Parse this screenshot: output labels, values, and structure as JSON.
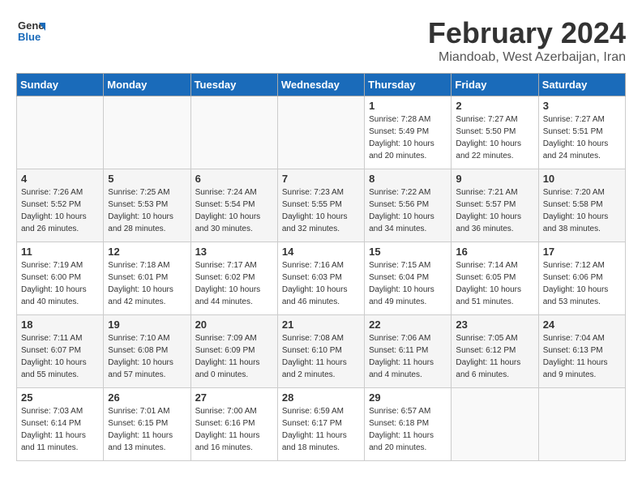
{
  "header": {
    "logo_general": "General",
    "logo_blue": "Blue",
    "month_year": "February 2024",
    "location": "Miandoab, West Azerbaijan, Iran"
  },
  "days_of_week": [
    "Sunday",
    "Monday",
    "Tuesday",
    "Wednesday",
    "Thursday",
    "Friday",
    "Saturday"
  ],
  "weeks": [
    [
      {
        "day": "",
        "sunrise": "",
        "sunset": "",
        "daylight": ""
      },
      {
        "day": "",
        "sunrise": "",
        "sunset": "",
        "daylight": ""
      },
      {
        "day": "",
        "sunrise": "",
        "sunset": "",
        "daylight": ""
      },
      {
        "day": "",
        "sunrise": "",
        "sunset": "",
        "daylight": ""
      },
      {
        "day": "1",
        "sunrise": "Sunrise: 7:28 AM",
        "sunset": "Sunset: 5:49 PM",
        "daylight": "Daylight: 10 hours and 20 minutes."
      },
      {
        "day": "2",
        "sunrise": "Sunrise: 7:27 AM",
        "sunset": "Sunset: 5:50 PM",
        "daylight": "Daylight: 10 hours and 22 minutes."
      },
      {
        "day": "3",
        "sunrise": "Sunrise: 7:27 AM",
        "sunset": "Sunset: 5:51 PM",
        "daylight": "Daylight: 10 hours and 24 minutes."
      }
    ],
    [
      {
        "day": "4",
        "sunrise": "Sunrise: 7:26 AM",
        "sunset": "Sunset: 5:52 PM",
        "daylight": "Daylight: 10 hours and 26 minutes."
      },
      {
        "day": "5",
        "sunrise": "Sunrise: 7:25 AM",
        "sunset": "Sunset: 5:53 PM",
        "daylight": "Daylight: 10 hours and 28 minutes."
      },
      {
        "day": "6",
        "sunrise": "Sunrise: 7:24 AM",
        "sunset": "Sunset: 5:54 PM",
        "daylight": "Daylight: 10 hours and 30 minutes."
      },
      {
        "day": "7",
        "sunrise": "Sunrise: 7:23 AM",
        "sunset": "Sunset: 5:55 PM",
        "daylight": "Daylight: 10 hours and 32 minutes."
      },
      {
        "day": "8",
        "sunrise": "Sunrise: 7:22 AM",
        "sunset": "Sunset: 5:56 PM",
        "daylight": "Daylight: 10 hours and 34 minutes."
      },
      {
        "day": "9",
        "sunrise": "Sunrise: 7:21 AM",
        "sunset": "Sunset: 5:57 PM",
        "daylight": "Daylight: 10 hours and 36 minutes."
      },
      {
        "day": "10",
        "sunrise": "Sunrise: 7:20 AM",
        "sunset": "Sunset: 5:58 PM",
        "daylight": "Daylight: 10 hours and 38 minutes."
      }
    ],
    [
      {
        "day": "11",
        "sunrise": "Sunrise: 7:19 AM",
        "sunset": "Sunset: 6:00 PM",
        "daylight": "Daylight: 10 hours and 40 minutes."
      },
      {
        "day": "12",
        "sunrise": "Sunrise: 7:18 AM",
        "sunset": "Sunset: 6:01 PM",
        "daylight": "Daylight: 10 hours and 42 minutes."
      },
      {
        "day": "13",
        "sunrise": "Sunrise: 7:17 AM",
        "sunset": "Sunset: 6:02 PM",
        "daylight": "Daylight: 10 hours and 44 minutes."
      },
      {
        "day": "14",
        "sunrise": "Sunrise: 7:16 AM",
        "sunset": "Sunset: 6:03 PM",
        "daylight": "Daylight: 10 hours and 46 minutes."
      },
      {
        "day": "15",
        "sunrise": "Sunrise: 7:15 AM",
        "sunset": "Sunset: 6:04 PM",
        "daylight": "Daylight: 10 hours and 49 minutes."
      },
      {
        "day": "16",
        "sunrise": "Sunrise: 7:14 AM",
        "sunset": "Sunset: 6:05 PM",
        "daylight": "Daylight: 10 hours and 51 minutes."
      },
      {
        "day": "17",
        "sunrise": "Sunrise: 7:12 AM",
        "sunset": "Sunset: 6:06 PM",
        "daylight": "Daylight: 10 hours and 53 minutes."
      }
    ],
    [
      {
        "day": "18",
        "sunrise": "Sunrise: 7:11 AM",
        "sunset": "Sunset: 6:07 PM",
        "daylight": "Daylight: 10 hours and 55 minutes."
      },
      {
        "day": "19",
        "sunrise": "Sunrise: 7:10 AM",
        "sunset": "Sunset: 6:08 PM",
        "daylight": "Daylight: 10 hours and 57 minutes."
      },
      {
        "day": "20",
        "sunrise": "Sunrise: 7:09 AM",
        "sunset": "Sunset: 6:09 PM",
        "daylight": "Daylight: 11 hours and 0 minutes."
      },
      {
        "day": "21",
        "sunrise": "Sunrise: 7:08 AM",
        "sunset": "Sunset: 6:10 PM",
        "daylight": "Daylight: 11 hours and 2 minutes."
      },
      {
        "day": "22",
        "sunrise": "Sunrise: 7:06 AM",
        "sunset": "Sunset: 6:11 PM",
        "daylight": "Daylight: 11 hours and 4 minutes."
      },
      {
        "day": "23",
        "sunrise": "Sunrise: 7:05 AM",
        "sunset": "Sunset: 6:12 PM",
        "daylight": "Daylight: 11 hours and 6 minutes."
      },
      {
        "day": "24",
        "sunrise": "Sunrise: 7:04 AM",
        "sunset": "Sunset: 6:13 PM",
        "daylight": "Daylight: 11 hours and 9 minutes."
      }
    ],
    [
      {
        "day": "25",
        "sunrise": "Sunrise: 7:03 AM",
        "sunset": "Sunset: 6:14 PM",
        "daylight": "Daylight: 11 hours and 11 minutes."
      },
      {
        "day": "26",
        "sunrise": "Sunrise: 7:01 AM",
        "sunset": "Sunset: 6:15 PM",
        "daylight": "Daylight: 11 hours and 13 minutes."
      },
      {
        "day": "27",
        "sunrise": "Sunrise: 7:00 AM",
        "sunset": "Sunset: 6:16 PM",
        "daylight": "Daylight: 11 hours and 16 minutes."
      },
      {
        "day": "28",
        "sunrise": "Sunrise: 6:59 AM",
        "sunset": "Sunset: 6:17 PM",
        "daylight": "Daylight: 11 hours and 18 minutes."
      },
      {
        "day": "29",
        "sunrise": "Sunrise: 6:57 AM",
        "sunset": "Sunset: 6:18 PM",
        "daylight": "Daylight: 11 hours and 20 minutes."
      },
      {
        "day": "",
        "sunrise": "",
        "sunset": "",
        "daylight": ""
      },
      {
        "day": "",
        "sunrise": "",
        "sunset": "",
        "daylight": ""
      }
    ]
  ]
}
